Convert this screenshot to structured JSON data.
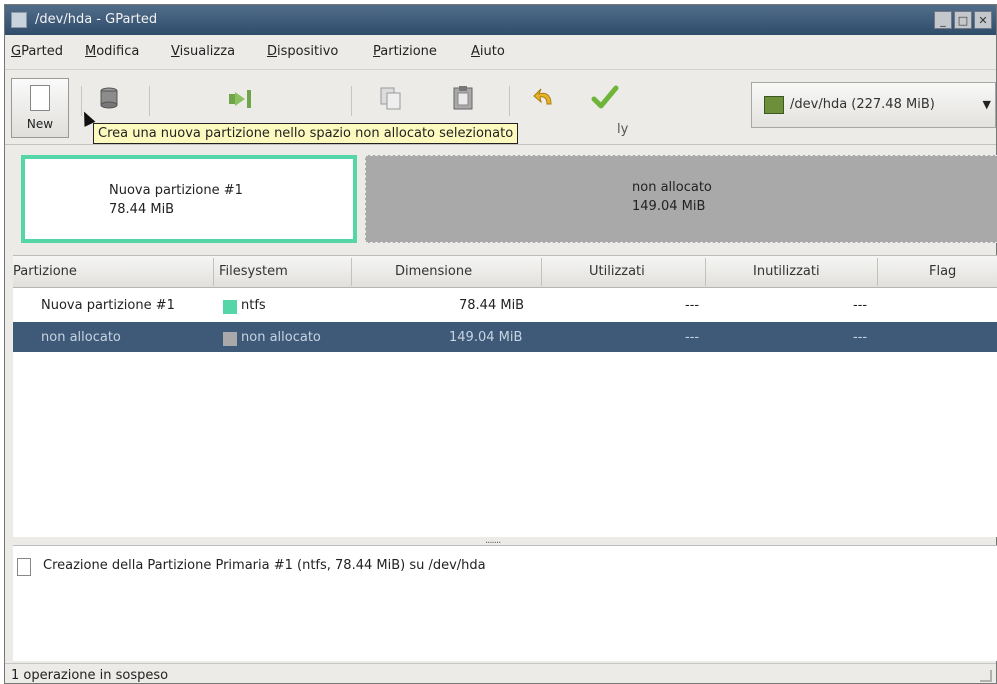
{
  "window": {
    "title": "/dev/hda - GParted"
  },
  "menubar": {
    "items": [
      "GParted",
      "Modifica",
      "Visualizza",
      "Dispositivo",
      "Partizione",
      "Aiuto"
    ]
  },
  "toolbar": {
    "new_label": "New",
    "apply_label_visible": "ly",
    "device_label": "/dev/hda  (227.48 MiB)",
    "icons": [
      "new-icon",
      "delete-icon",
      "resize-move-icon",
      "copy-icon",
      "paste-icon",
      "undo-icon",
      "apply-icon"
    ]
  },
  "tooltip": {
    "text": "Crea una nuova partizione nello spazio non allocato selezionato"
  },
  "partition_map": {
    "new": {
      "name": "Nuova partizione #1",
      "size": "78.44 MiB",
      "color": "#55d6a8"
    },
    "unallocated": {
      "name": "non allocato",
      "size": "149.04 MiB",
      "color": "#a9a9a9"
    }
  },
  "table": {
    "headers": [
      "Partizione",
      "Filesystem",
      "Dimensione",
      "Utilizzati",
      "Inutilizzati",
      "Flag"
    ],
    "rows": [
      {
        "partition": "Nuova partizione #1",
        "filesystem": "ntfs",
        "fs_color": "#55d6a8",
        "size": "78.44 MiB",
        "used": "---",
        "unused": "---",
        "flag": ""
      },
      {
        "partition": "non allocato",
        "filesystem": "non allocato",
        "fs_color": "#a9a9a9",
        "size": "149.04 MiB",
        "used": "---",
        "unused": "---",
        "flag": ""
      }
    ]
  },
  "operations": [
    "Creazione della Partizione Primaria #1 (ntfs, 78.44 MiB) su /dev/hda"
  ],
  "status": {
    "text": "1 operazione in sospeso"
  }
}
